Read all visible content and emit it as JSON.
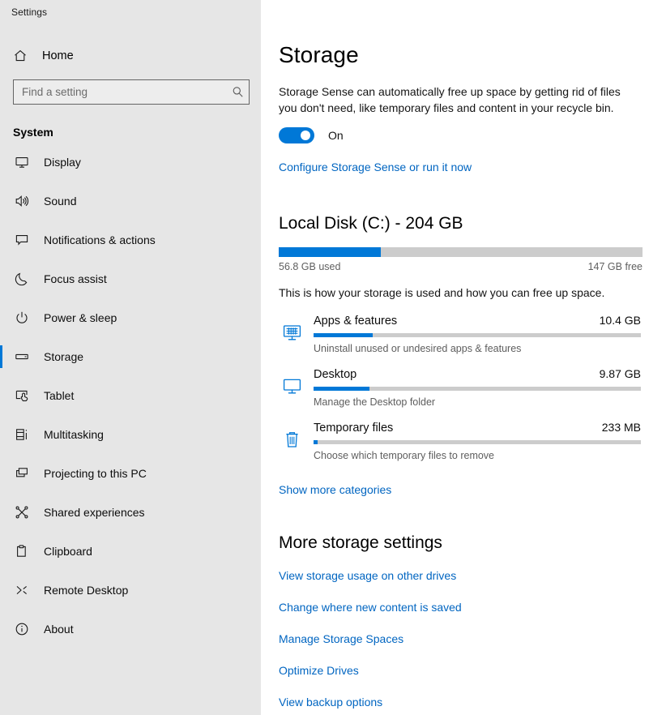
{
  "window": {
    "title": "Settings"
  },
  "sidebar": {
    "home_label": "Home",
    "home_icon": "home-icon",
    "search": {
      "placeholder": "Find a setting",
      "value": "",
      "icon": "search-icon"
    },
    "group_title": "System",
    "items": [
      {
        "label": "Display",
        "icon": "monitor-icon",
        "selected": false
      },
      {
        "label": "Sound",
        "icon": "speaker-icon",
        "selected": false
      },
      {
        "label": "Notifications & actions",
        "icon": "chat-bubble-icon",
        "selected": false
      },
      {
        "label": "Focus assist",
        "icon": "moon-icon",
        "selected": false
      },
      {
        "label": "Power & sleep",
        "icon": "power-icon",
        "selected": false
      },
      {
        "label": "Storage",
        "icon": "drive-icon",
        "selected": true
      },
      {
        "label": "Tablet",
        "icon": "tablet-touch-icon",
        "selected": false
      },
      {
        "label": "Multitasking",
        "icon": "multitasking-icon",
        "selected": false
      },
      {
        "label": "Projecting to this PC",
        "icon": "projecting-icon",
        "selected": false
      },
      {
        "label": "Shared experiences",
        "icon": "share-nodes-icon",
        "selected": false
      },
      {
        "label": "Clipboard",
        "icon": "clipboard-icon",
        "selected": false
      },
      {
        "label": "Remote Desktop",
        "icon": "remote-desktop-icon",
        "selected": false
      },
      {
        "label": "About",
        "icon": "info-icon",
        "selected": false
      }
    ]
  },
  "main": {
    "page_title": "Storage",
    "storage_sense": {
      "description": "Storage Sense can automatically free up space by getting rid of files you don't need, like temporary files and content in your recycle bin.",
      "toggle_state": "On",
      "toggle_on": true,
      "configure_link": "Configure Storage Sense or run it now"
    },
    "local_disk": {
      "title": "Local Disk (C:) - 204 GB",
      "used_label": "56.8 GB used",
      "free_label": "147 GB free",
      "used_percent": 28,
      "usage_description": "This is how your storage is used and how you can free up space.",
      "categories": [
        {
          "name": "Apps & features",
          "size": "10.4 GB",
          "subtitle": "Uninstall unused or undesired apps & features",
          "percent": 18,
          "icon": "apps-monitor-icon"
        },
        {
          "name": "Desktop",
          "size": "9.87 GB",
          "subtitle": "Manage the Desktop folder",
          "percent": 17,
          "icon": "desktop-monitor-icon"
        },
        {
          "name": "Temporary files",
          "size": "233 MB",
          "subtitle": "Choose which temporary files to remove",
          "percent": 1.2,
          "icon": "trash-icon"
        }
      ],
      "show_more_label": "Show more categories"
    },
    "more_storage_settings": {
      "title": "More storage settings",
      "links": [
        "View storage usage on other drives",
        "Change where new content is saved",
        "Manage Storage Spaces",
        "Optimize Drives",
        "View backup options"
      ]
    }
  },
  "colors": {
    "accent": "#0078d7",
    "link": "#0065c1",
    "sidebar_bg": "#e6e6e6",
    "track": "#cccccc"
  }
}
